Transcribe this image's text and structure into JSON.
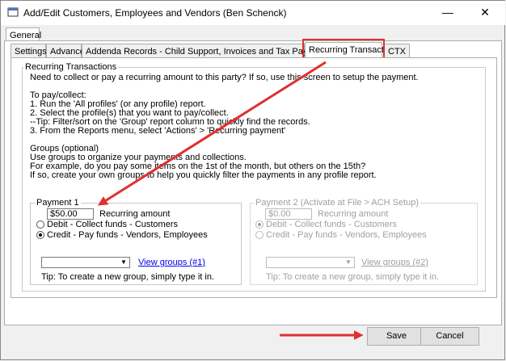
{
  "window": {
    "title": "Add/Edit Customers, Employees and Vendors (Ben Schenck)",
    "controls": {
      "minimize": "—",
      "maximize": "☐",
      "close": "✕"
    }
  },
  "outer_tab": "General",
  "tabs": [
    "Settings",
    "Advanced",
    "Addenda Records - Child Support, Invoices and Tax Payments (TXP)",
    "Recurring Transactions",
    "CTX"
  ],
  "section_title": "Recurring Transactions",
  "intro": "Need to collect or pay a recurring amount to this party?  If so, use this screen to setup the payment.",
  "to_pay_heading": "To pay/collect:",
  "steps": [
    "1. Run the 'All profiles' (or any profile) report.",
    "2. Select the profile(s) that you want to pay/collect.",
    "  --Tip: Filter/sort on the 'Group' report column to quickly find the records.",
    "3. From the Reports menu, select 'Actions' > 'Recurring payment'"
  ],
  "groups_heading": "Groups (optional)",
  "groups_lines": [
    "Use groups to organize your payments and collections.",
    "For example, do you pay some items on the 1st of the month, but others on the 15th?",
    "If so, create your own groups to help you quickly filter the payments in any profile report."
  ],
  "payment1": {
    "label": "Payment 1",
    "amount": "$50.00",
    "amount_label": "Recurring amount",
    "debit": "Debit - Collect funds - Customers",
    "credit": "Credit - Pay funds - Vendors, Employees",
    "selected": "credit",
    "view_groups": "View groups (#1)",
    "tip": "Tip: To create a new group, simply type it in."
  },
  "payment2": {
    "label": "Payment 2  (Activate at File > ACH Setup)",
    "amount": "$0.00",
    "amount_label": "Recurring amount",
    "debit": "Debit - Collect funds - Customers",
    "credit": "Credit - Pay funds - Vendors, Employees",
    "selected": "debit",
    "view_groups": "View groups (#2)",
    "tip": "Tip: To create a new group, simply type it in."
  },
  "buttons": {
    "save": "Save",
    "cancel": "Cancel"
  },
  "colors": {
    "highlight": "#e0302f",
    "link": "#0000ee",
    "disabled": "#a0a0a0"
  }
}
